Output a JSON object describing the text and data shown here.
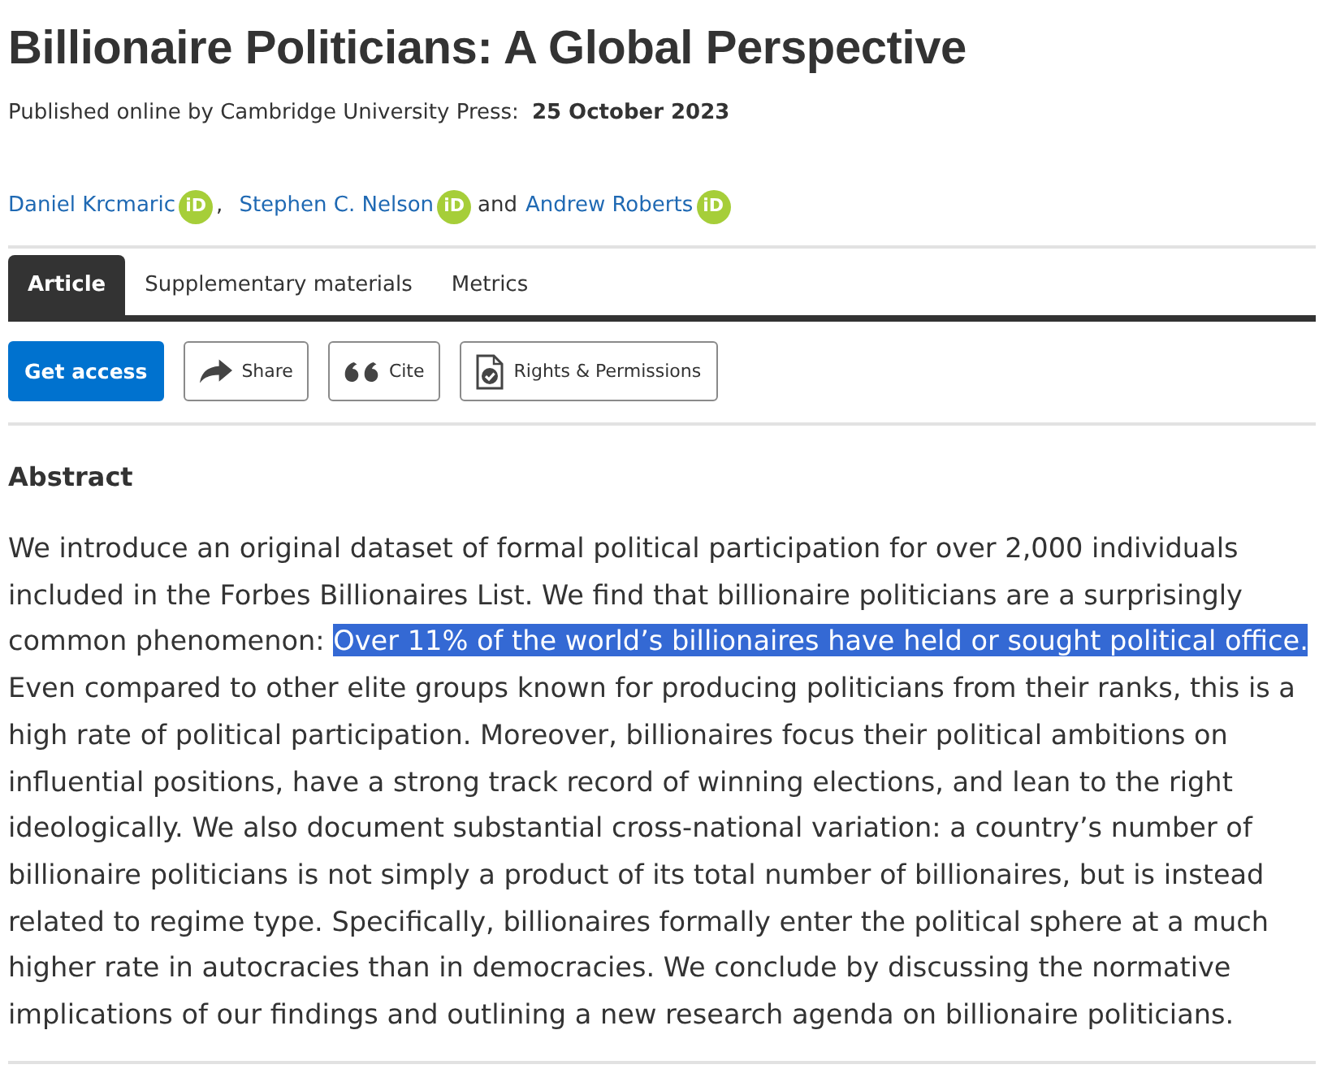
{
  "article": {
    "title": "Billionaire Politicians: A Global Perspective",
    "published_label": "Published online by Cambridge University Press:",
    "published_date": "25 October 2023"
  },
  "authors": [
    {
      "name": "Daniel Krcmaric",
      "badge": "iD",
      "separator": ","
    },
    {
      "name": "Stephen C. Nelson",
      "badge": "iD",
      "separator": "and"
    },
    {
      "name": "Andrew Roberts",
      "badge": "iD"
    }
  ],
  "tabs": [
    {
      "label": "Article",
      "selected": true
    },
    {
      "label": "Supplementary materials",
      "selected": false
    },
    {
      "label": "Metrics",
      "selected": false
    }
  ],
  "actions": [
    {
      "label": "Get access",
      "kind": "primary"
    },
    {
      "label": "Share",
      "kind": "share"
    },
    {
      "label": "Cite",
      "kind": "cite"
    },
    {
      "label": "Rights & Permissions",
      "kind": "rights"
    }
  ],
  "abstract": {
    "heading": "Abstract",
    "segments": [
      {
        "text": "We introduce an original dataset of formal political participation for over 2,000 individuals included in the Forbes Billionaires List. We find that billionaire politicians are a surprisingly common phenomenon:",
        "selected": false
      },
      {
        "text": "Over 11% of the world’s billionaires have held or sought political office.",
        "selected": true
      },
      {
        "text": "Even compared to other elite groups known for producing politicians from their ranks, this is a high rate of political participation. Moreover, billionaires focus their political ambitions on influential positions, have a strong track record of winning elections, and lean to the right ideologically. We also document substantial cross-national variation: a country’s number of billionaire politicians is not simply a product of its total number of billionaires, but is instead related to regime type. Specifically, billionaires formally enter the political sphere at a much higher rate in autocracies than in democracies. We conclude by discussing the normative implications of our findings and outlining a new research agenda on billionaire politicians.",
        "selected": false
      }
    ]
  }
}
